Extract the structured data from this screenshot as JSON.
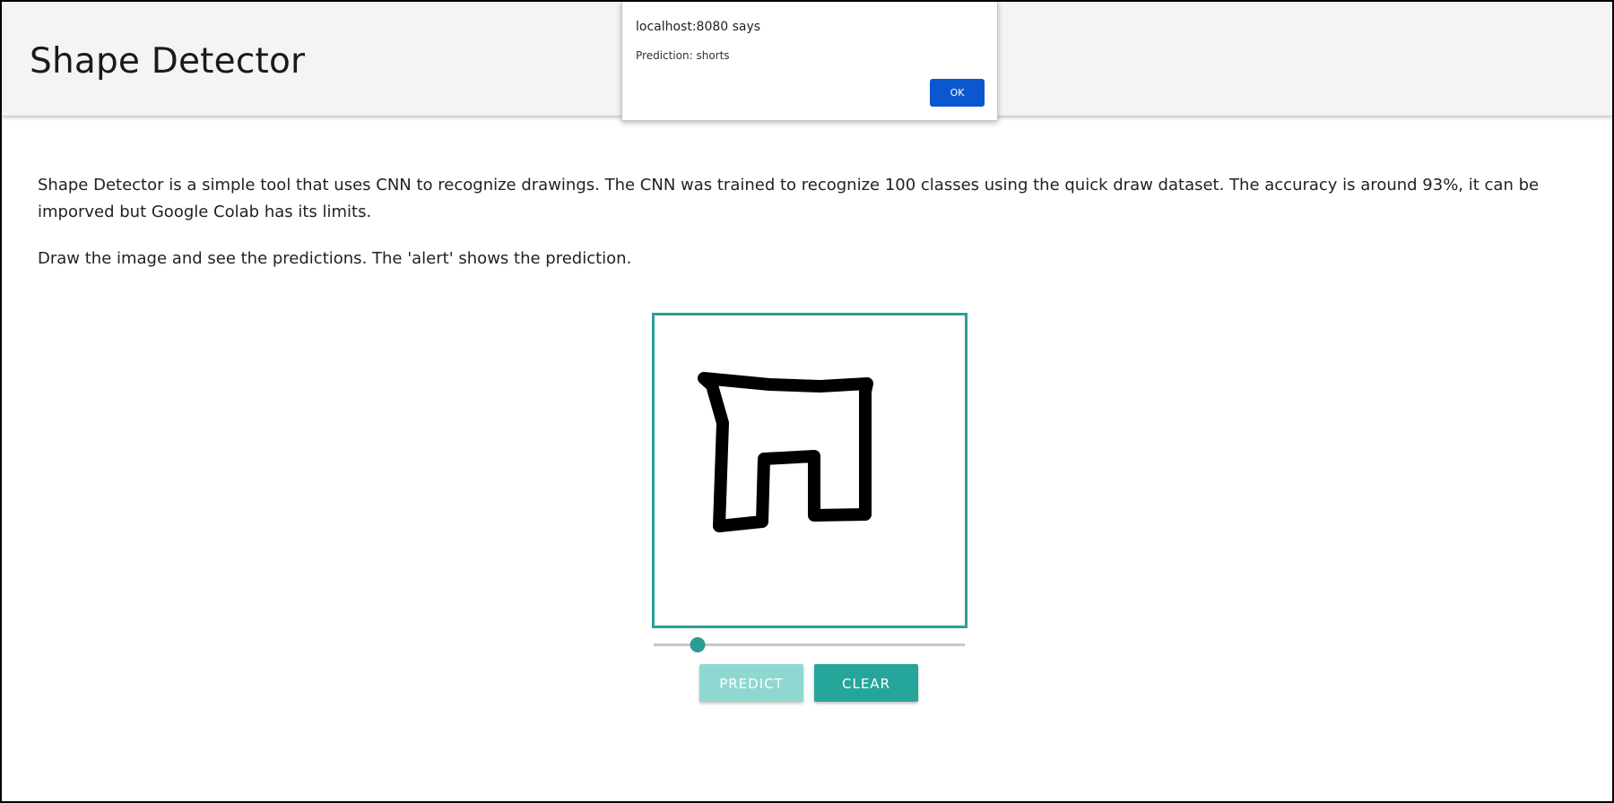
{
  "header": {
    "title": "Shape Detector"
  },
  "intro": {
    "paragraph1": "Shape Detector is a simple tool that uses CNN to recognize drawings. The CNN was trained to recognize 100 classes using the quick draw dataset. The accuracy is around 93%, it can be imporved but Google Colab has its limits.",
    "paragraph2": "Draw the image and see the predictions. The 'alert' shows the prediction."
  },
  "drawing_canvas": {
    "stroke_color": "#000000",
    "border_color": "#2f9e97"
  },
  "brush_slider": {
    "value_fraction": 0.14
  },
  "buttons": {
    "predict_label": "PREDICT",
    "clear_label": "CLEAR"
  },
  "alert_dialog": {
    "title": "localhost:8080 says",
    "message": "Prediction: shorts",
    "ok_label": "OK"
  },
  "colors": {
    "accent": "#26a69a",
    "accent_disabled": "#8fd8d2",
    "dialog_ok": "#0b57d0",
    "header_bg": "#f4f4f4"
  }
}
